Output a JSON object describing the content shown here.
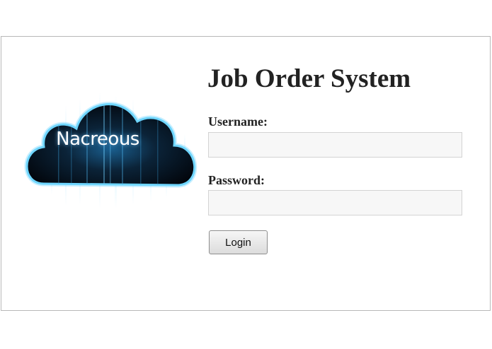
{
  "logo": {
    "text": "Nacreous",
    "icon": "cloud-logo"
  },
  "form": {
    "title": "Job Order System",
    "username_label": "Username:",
    "username_value": "",
    "password_label": "Password:",
    "password_value": "",
    "login_label": "Login"
  },
  "colors": {
    "cloud_glow": "#5fd0ff",
    "cloud_dark": "#0a0f1a",
    "cloud_mid": "#1f6fa8"
  }
}
